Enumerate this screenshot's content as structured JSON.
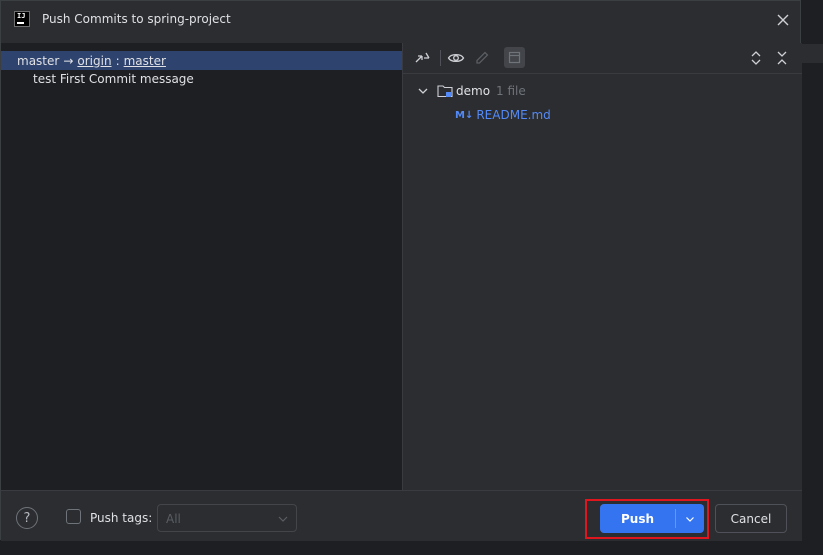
{
  "window": {
    "title": "Push Commits to spring-project",
    "logo_text": "IJ"
  },
  "left_pane": {
    "branch": {
      "local": "master",
      "arrow": "→",
      "remote": "origin",
      "separator": ":",
      "remote_branch": "master"
    },
    "commits": [
      {
        "message": "test First Commit message"
      }
    ]
  },
  "right_pane": {
    "toolbar_icons": [
      "collapse-to-left-icon",
      "eye-icon",
      "edit-icon",
      "show-diff-icon",
      "expand-all-icon",
      "collapse-all-icon"
    ],
    "tree": {
      "folder": {
        "name": "demo",
        "count": "1 file"
      },
      "file": {
        "badge": "M↓",
        "name": "README.md"
      }
    }
  },
  "footer": {
    "help": "?",
    "push_tags_label": "Push tags:",
    "push_tags_checked": false,
    "tags_select_value": "All",
    "push_label": "Push",
    "cancel_label": "Cancel"
  },
  "colors": {
    "accent": "#3574f0",
    "selection": "#2e436e",
    "highlight_box": "#e0161e",
    "link": "#548af7"
  }
}
